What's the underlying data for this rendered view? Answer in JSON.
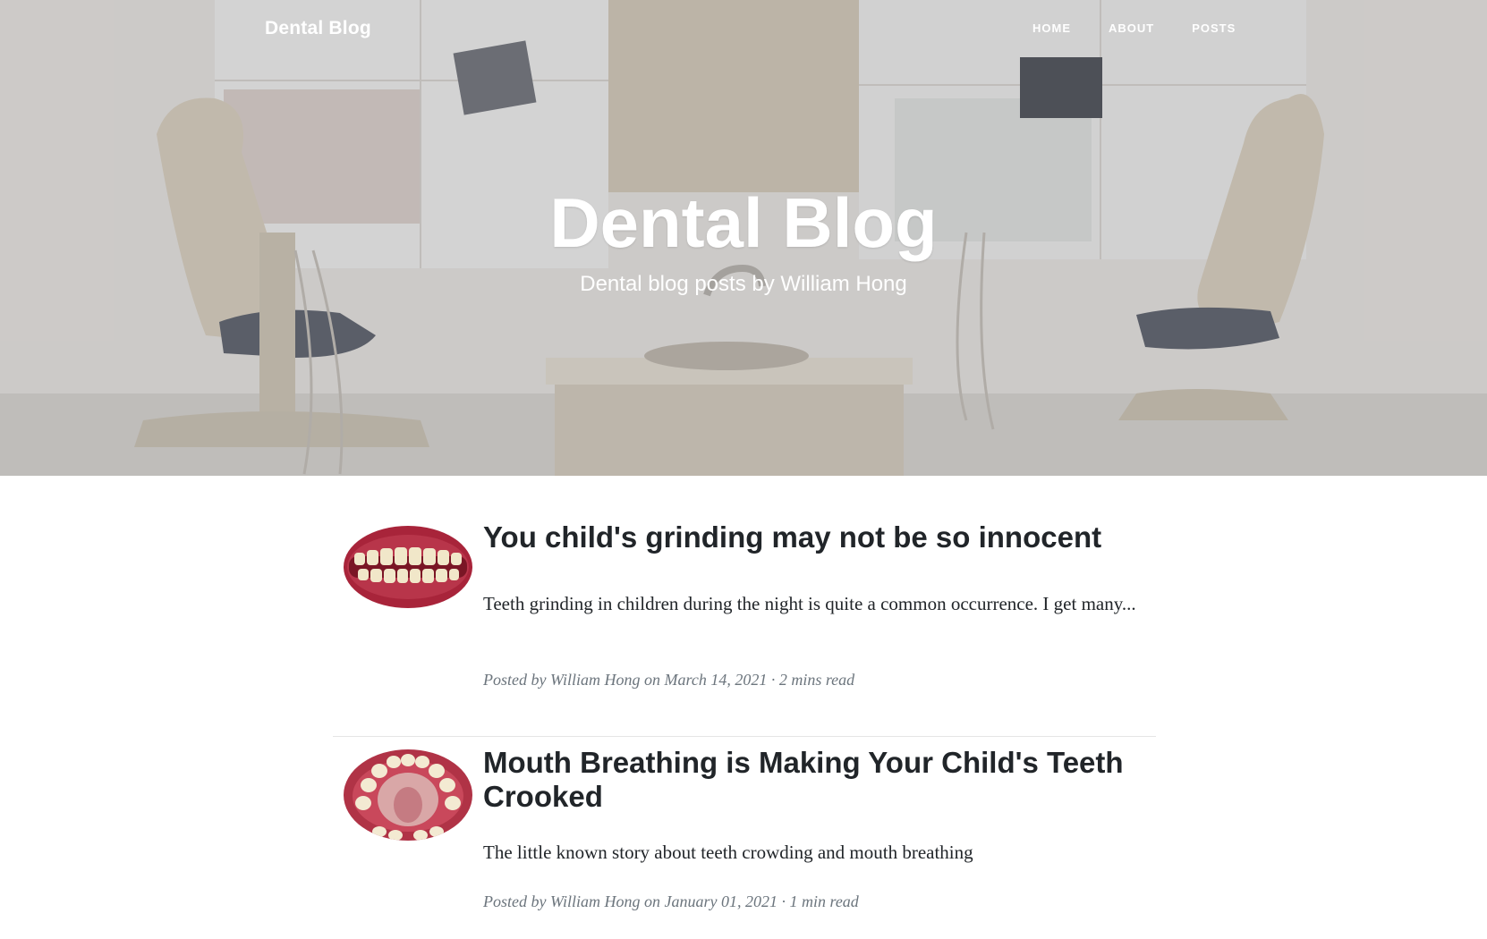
{
  "navbar": {
    "brand": "Dental Blog",
    "links": [
      {
        "label": "HOME"
      },
      {
        "label": "ABOUT"
      },
      {
        "label": "POSTS"
      }
    ]
  },
  "hero": {
    "title": "Dental Blog",
    "subtitle": "Dental blog posts by William Hong"
  },
  "posts": [
    {
      "title": "You child's grinding may not be so innocent",
      "excerpt": "Teeth grinding in children during the night is quite a common occurrence. I get many...",
      "meta_prefix": "Posted by",
      "author": "William Hong",
      "date": "on March 14, 2021",
      "read_time": "· 2 mins read",
      "thumbnail": "grinding-teeth-photo"
    },
    {
      "title": "Mouth Breathing is Making Your Child's Teeth Crooked",
      "excerpt": "The little known story about teeth crowding and mouth breathing",
      "meta_prefix": "Posted by",
      "author": "William Hong",
      "date": "on January 01, 2021",
      "read_time": "· 1 min read",
      "thumbnail": "crowded-teeth-photo"
    }
  ],
  "colors": {
    "text": "#212529",
    "meta": "#6c757d",
    "hero_text": "#ffffff",
    "divider": "#e5e5e5"
  }
}
